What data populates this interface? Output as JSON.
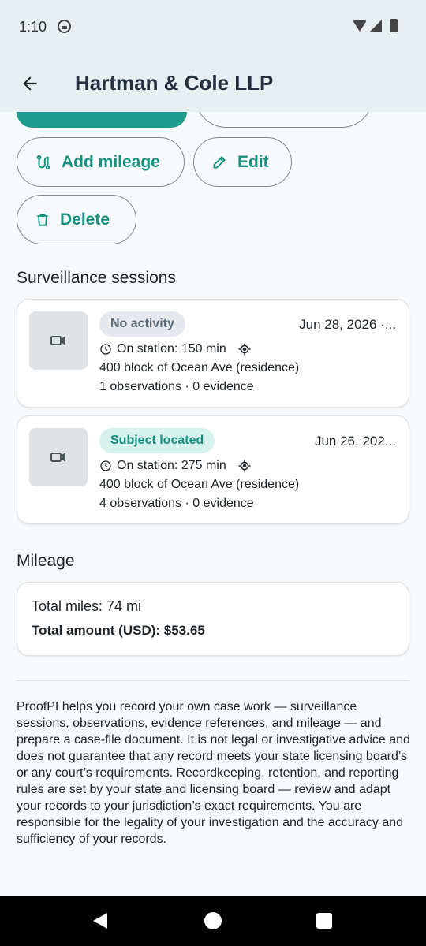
{
  "status_bar": {
    "time": "1:10"
  },
  "app_bar": {
    "title": "Hartman & Cole LLP"
  },
  "actions": {
    "add_mileage": "Add mileage",
    "edit": "Edit",
    "delete": "Delete"
  },
  "sessions": {
    "title": "Surveillance sessions",
    "items": [
      {
        "status": "No activity",
        "date": "Jun 28, 2026 ·...",
        "on_station": "On station: 150 min",
        "location": "400 block of Ocean Ave (residence)",
        "counts": "1 observations · 0 evidence"
      },
      {
        "status": "Subject located",
        "date": "Jun 26, 202...",
        "on_station": "On station: 275 min",
        "location": "400 block of Ocean Ave (residence)",
        "counts": "4 observations · 0 evidence"
      }
    ]
  },
  "mileage": {
    "title": "Mileage",
    "total_miles": "Total miles: 74 mi",
    "total_amount": "Total amount (USD): $53.65"
  },
  "disclaimer": "ProofPI helps you record your own case work — surveillance sessions, observations, evidence references, and mileage — and prepare a case-file document. It is not legal or investigative advice and does not guarantee that any record meets your state licensing board’s or any court’s requirements. Recordkeeping, retention, and reporting rules are set by your state and licensing board — review and adapt your records to your jurisdiction’s exact requirements. You are responsible for the legality of your investigation and the accuracy and sufficiency of your records.",
  "colors": {
    "accent": "#17917f",
    "app_bar_bg": "#e7eff2",
    "badge_grey_bg": "#e5e9ee",
    "badge_teal_bg": "#d7f1ec"
  }
}
